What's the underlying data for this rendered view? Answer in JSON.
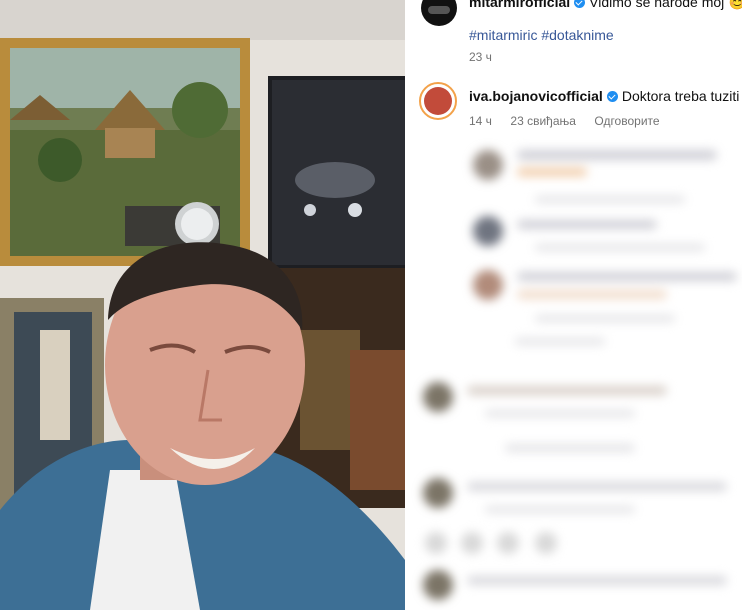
{
  "first_comment": {
    "username": "mitarmirofficial",
    "text": "Vidimo se narode moj",
    "emoji": "😊",
    "hashtags": "#mitarmiric #dotaknime",
    "time": "23 ч"
  },
  "second_comment": {
    "username": "iva.bojanovicofficial",
    "text": "Doktora treba tuziti",
    "emoji": "☝",
    "time": "14 ч",
    "likes": "23 свиђања",
    "reply": "Одговорите"
  },
  "colors": {
    "verified": "#1f8ef1",
    "meta": "#737373",
    "hashtag": "#385898"
  }
}
